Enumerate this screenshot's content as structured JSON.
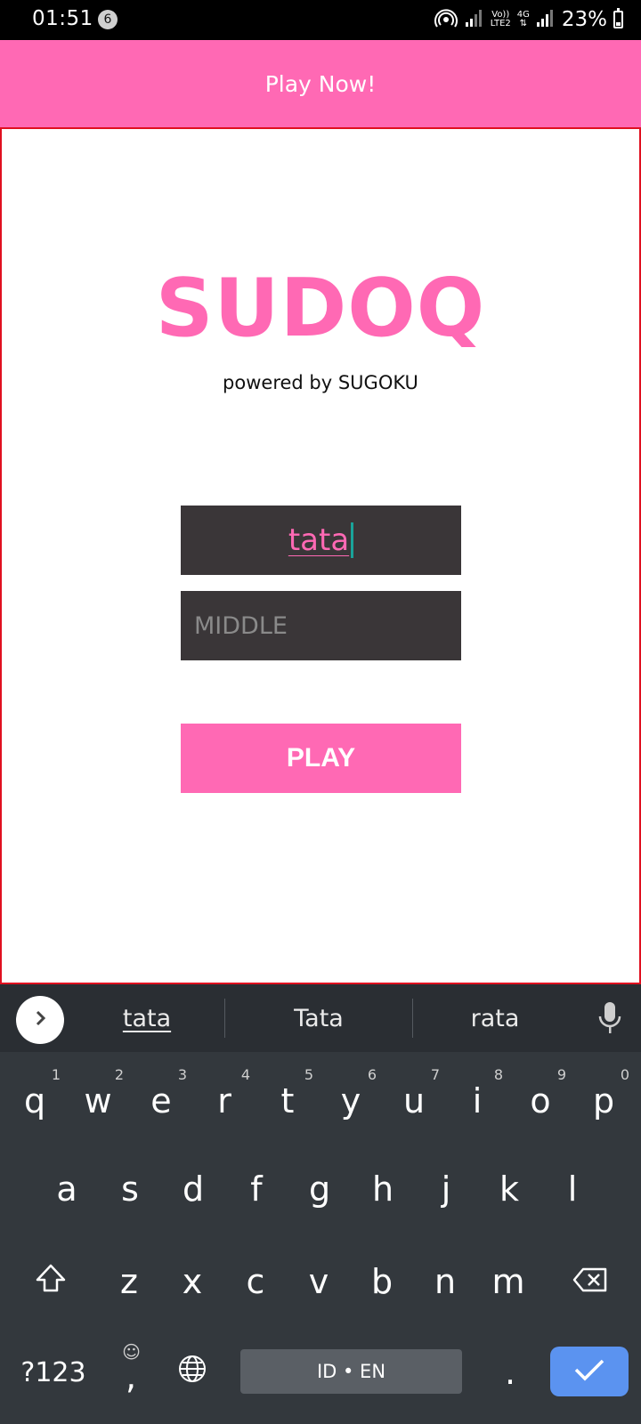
{
  "status_bar": {
    "time": "01:51",
    "notification_count": "6",
    "network_label_top": "Vo))",
    "network_label_bottom": "LTE2",
    "data_label": "4G",
    "battery_text": "23%",
    "battery_level": 0.23
  },
  "app_bar": {
    "title": "Play Now!"
  },
  "main": {
    "logo": "SUDOQ",
    "subtitle": "powered by SUGOKU",
    "name_input": {
      "value": "tata"
    },
    "difficulty_input": {
      "placeholder": "MIDDLE"
    },
    "play_button": "PLAY"
  },
  "keyboard": {
    "suggestions": [
      "tata",
      "Tata",
      "rata"
    ],
    "row1": [
      {
        "key": "q",
        "hint": "1"
      },
      {
        "key": "w",
        "hint": "2"
      },
      {
        "key": "e",
        "hint": "3"
      },
      {
        "key": "r",
        "hint": "4"
      },
      {
        "key": "t",
        "hint": "5"
      },
      {
        "key": "y",
        "hint": "6"
      },
      {
        "key": "u",
        "hint": "7"
      },
      {
        "key": "i",
        "hint": "8"
      },
      {
        "key": "o",
        "hint": "9"
      },
      {
        "key": "p",
        "hint": "0"
      }
    ],
    "row2": [
      "a",
      "s",
      "d",
      "f",
      "g",
      "h",
      "j",
      "k",
      "l"
    ],
    "row3": [
      "z",
      "x",
      "c",
      "v",
      "b",
      "n",
      "m"
    ],
    "symbols_key": "?123",
    "comma_key": ",",
    "emoji_hint": "☺",
    "space_label": "ID • EN",
    "period_key": ".",
    "accent_color": "#5b93f0"
  },
  "colors": {
    "brand": "#ff69b4",
    "field_bg": "#3a3638",
    "frame_border": "#e01020"
  }
}
